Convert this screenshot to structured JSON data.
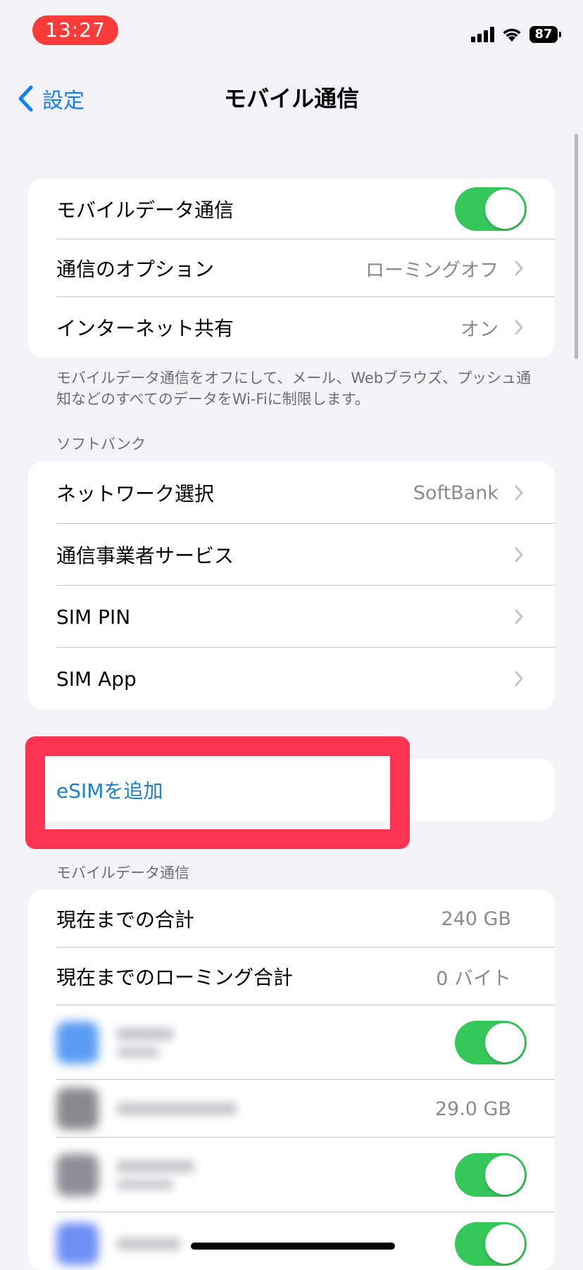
{
  "status_bar": {
    "time": "13:27",
    "battery": "87"
  },
  "nav": {
    "back_label": "設定",
    "title": "モバイル通信"
  },
  "main_group": {
    "mobile_data_label": "モバイルデータ通信",
    "mobile_data_on": true,
    "options_label": "通信のオプション",
    "options_value": "ローミングオフ",
    "hotspot_label": "インターネット共有",
    "hotspot_value": "オン"
  },
  "footnote": "モバイルデータ通信をオフにして、メール、Webブラウズ、プッシュ通知などのすべてのデータをWi-Fiに制限します。",
  "carrier_section": {
    "header": "ソフトバンク",
    "network_label": "ネットワーク選択",
    "network_value": "SoftBank",
    "carrier_services_label": "通信事業者サービス",
    "sim_pin_label": "SIM PIN",
    "sim_app_label": "SIM App"
  },
  "esim": {
    "label": "eSIMを追加"
  },
  "usage_section": {
    "header": "モバイルデータ通信",
    "current_total_label": "現在までの合計",
    "current_total_value": "240 GB",
    "roaming_total_label": "現在までのローミング合計",
    "roaming_total_value": "0 バイト",
    "app_values": [
      "",
      "29.0 GB",
      "",
      ""
    ]
  },
  "colors": {
    "accent": "#147efb",
    "toggle_on": "#34c759",
    "highlight": "#fd3451"
  }
}
